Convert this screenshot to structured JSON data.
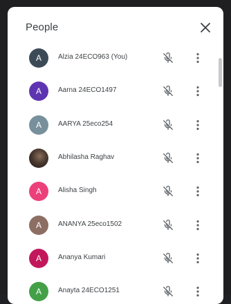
{
  "panel": {
    "title": "People"
  },
  "icons": {
    "close": "close-icon",
    "mic_off": "mic-off-icon",
    "more": "more-vert-icon"
  },
  "participants": [
    {
      "name": "Alzia 24ECO963 (You)",
      "initial": "A",
      "avatar_color": "#3c4a57"
    },
    {
      "name": "Aarna 24ECO1497",
      "initial": "A",
      "avatar_color": "#5e35b1"
    },
    {
      "name": "AARYA 25eco254",
      "initial": "A",
      "avatar_color": "#78909c"
    },
    {
      "name": "Abhilasha Raghav",
      "initial": "",
      "avatar_color": "photo"
    },
    {
      "name": "Alisha Singh",
      "initial": "A",
      "avatar_color": "#ec407a"
    },
    {
      "name": "ANANYA 25eco1502",
      "initial": "A",
      "avatar_color": "#8d6e63"
    },
    {
      "name": "Ananya Kumari",
      "initial": "A",
      "avatar_color": "#c2185b"
    },
    {
      "name": "Anayta 24ECO1251",
      "initial": "A",
      "avatar_color": "#43a047"
    }
  ]
}
